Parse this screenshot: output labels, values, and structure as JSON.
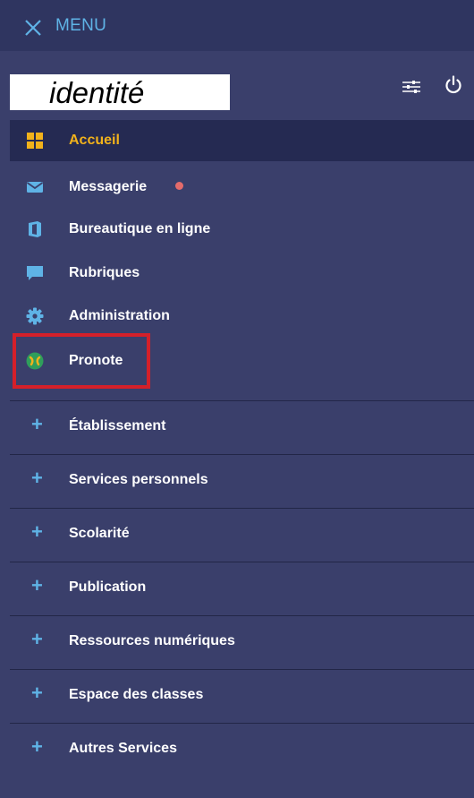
{
  "header": {
    "menu_label": "MENU"
  },
  "identity": {
    "text": "identité"
  },
  "nav_items": [
    {
      "label": "Accueil",
      "icon": "home-grid-icon",
      "active": true
    },
    {
      "label": "Messagerie",
      "icon": "envelope-icon",
      "notification": true
    },
    {
      "label": "Bureautique en ligne",
      "icon": "office-icon"
    },
    {
      "label": "Rubriques",
      "icon": "chat-bubble-icon"
    },
    {
      "label": "Administration",
      "icon": "gear-icon"
    },
    {
      "label": "Pronote",
      "icon": "pronote-logo-icon"
    }
  ],
  "sections": [
    {
      "label": "Établissement"
    },
    {
      "label": "Services personnels"
    },
    {
      "label": "Scolarité"
    },
    {
      "label": "Publication"
    },
    {
      "label": "Ressources numériques"
    },
    {
      "label": "Espace des classes"
    },
    {
      "label": "Autres Services"
    }
  ],
  "colors": {
    "background": "#3a3f6b",
    "topbar": "#2f3560",
    "active_row": "#252a52",
    "accent_blue": "#5fb3e6",
    "active_text": "#f2b21b",
    "highlight_border": "#d4202a",
    "notification_dot": "#e46b6b"
  }
}
